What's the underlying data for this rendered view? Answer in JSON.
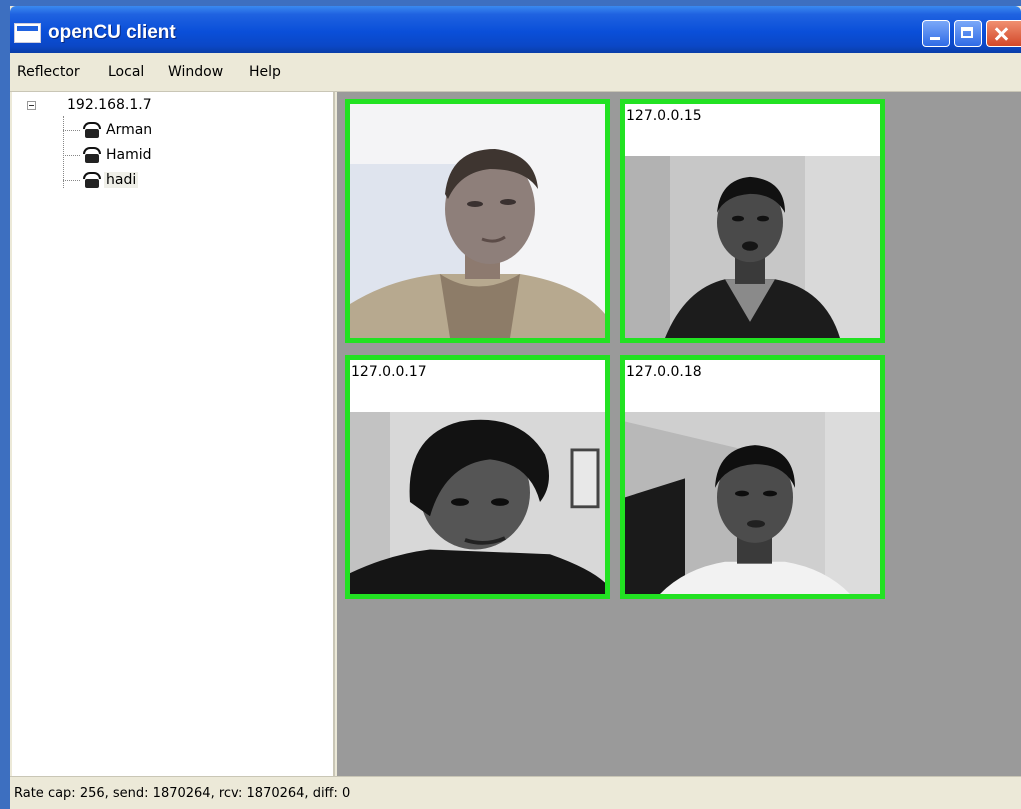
{
  "window": {
    "title": "openCU client",
    "controls": [
      "minimize-icon",
      "maximize-icon",
      "close-icon"
    ]
  },
  "menu": {
    "items": [
      {
        "label": "Reflector"
      },
      {
        "label": "Local"
      },
      {
        "label": "Window"
      },
      {
        "label": "Help"
      }
    ]
  },
  "tree": {
    "root": {
      "label": "192.168.1.7",
      "expanded": true
    },
    "items": [
      {
        "label": "Arman",
        "icon": "phone-icon"
      },
      {
        "label": "Hamid",
        "icon": "phone-icon"
      },
      {
        "label": "hadi",
        "icon": "phone-icon",
        "selected": true
      }
    ]
  },
  "video": {
    "tiles": [
      {
        "label": ""
      },
      {
        "label": "127.0.0.15"
      },
      {
        "label": "127.0.0.17"
      },
      {
        "label": "127.0.0.18"
      }
    ],
    "border_color": "#22e222"
  },
  "status": {
    "text": "Rate cap: 256, send: 1870264, rcv: 1870264, diff: 0"
  }
}
